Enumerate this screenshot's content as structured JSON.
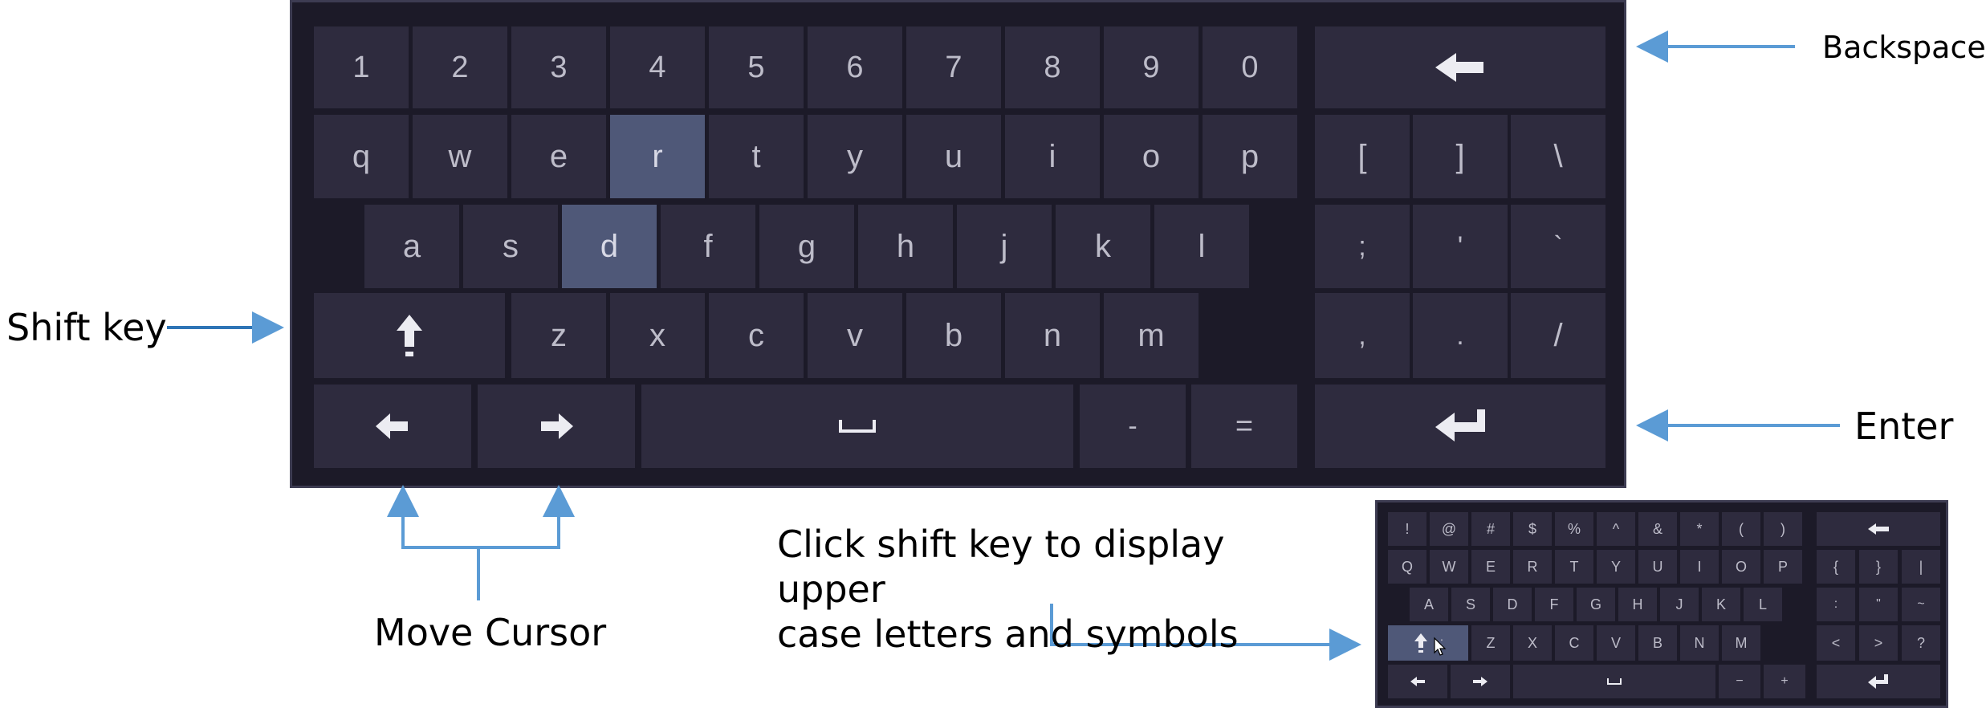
{
  "main_keyboard": {
    "numbers": [
      "1",
      "2",
      "3",
      "4",
      "5",
      "6",
      "7",
      "8",
      "9",
      "0"
    ],
    "row_q": [
      "q",
      "w",
      "e",
      "r",
      "t",
      "y",
      "u",
      "i",
      "o",
      "p"
    ],
    "row_a": [
      "a",
      "s",
      "d",
      "f",
      "g",
      "h",
      "j",
      "k",
      "l"
    ],
    "row_z": [
      "z",
      "x",
      "c",
      "v",
      "b",
      "n",
      "m"
    ],
    "symbols_row1": [
      "[",
      "]",
      "\\"
    ],
    "symbols_row2": [
      ";",
      "'",
      "`"
    ],
    "symbols_row3": [
      ",",
      ".",
      "/"
    ],
    "dash": "-",
    "equals": "=",
    "highlighted": [
      "r",
      "d"
    ],
    "icons": {
      "backspace": "left-arrow-icon",
      "shift": "up-arrow-icon",
      "cursor_left": "left-arrow-icon",
      "cursor_right": "right-arrow-icon",
      "space": "space-bar-icon",
      "enter": "enter-icon"
    },
    "colors": {
      "frame": "#1c1a28",
      "key": "#2e2b3e",
      "highlight": "#4f5878",
      "key_text": "#bdbcc9"
    }
  },
  "mini_keyboard": {
    "numbers": [
      "!",
      "@",
      "#",
      "$",
      "%",
      "^",
      "&",
      "*",
      "(",
      ")"
    ],
    "row_q": [
      "Q",
      "W",
      "E",
      "R",
      "T",
      "Y",
      "U",
      "I",
      "O",
      "P"
    ],
    "row_a": [
      "A",
      "S",
      "D",
      "F",
      "G",
      "H",
      "J",
      "K",
      "L"
    ],
    "row_z": [
      ":",
      "Z",
      "X",
      "C",
      "V",
      "B",
      "N",
      "M"
    ],
    "symbols_row1": [
      "{",
      "}",
      "|"
    ],
    "symbols_row2": [
      ":",
      "\"",
      "~"
    ],
    "symbols_row3": [
      "<",
      ">",
      "?"
    ],
    "dash": "−",
    "plus": "+"
  },
  "annotations": {
    "backspace": "Backspace",
    "enter": "Enter",
    "shift_key": "Shift key",
    "move_cursor": "Move Cursor",
    "shift_hint_line1": "Click shift key to display upper",
    "shift_hint_line2": "case letters and symbols",
    "arrow_color": "#5b9bd5"
  }
}
